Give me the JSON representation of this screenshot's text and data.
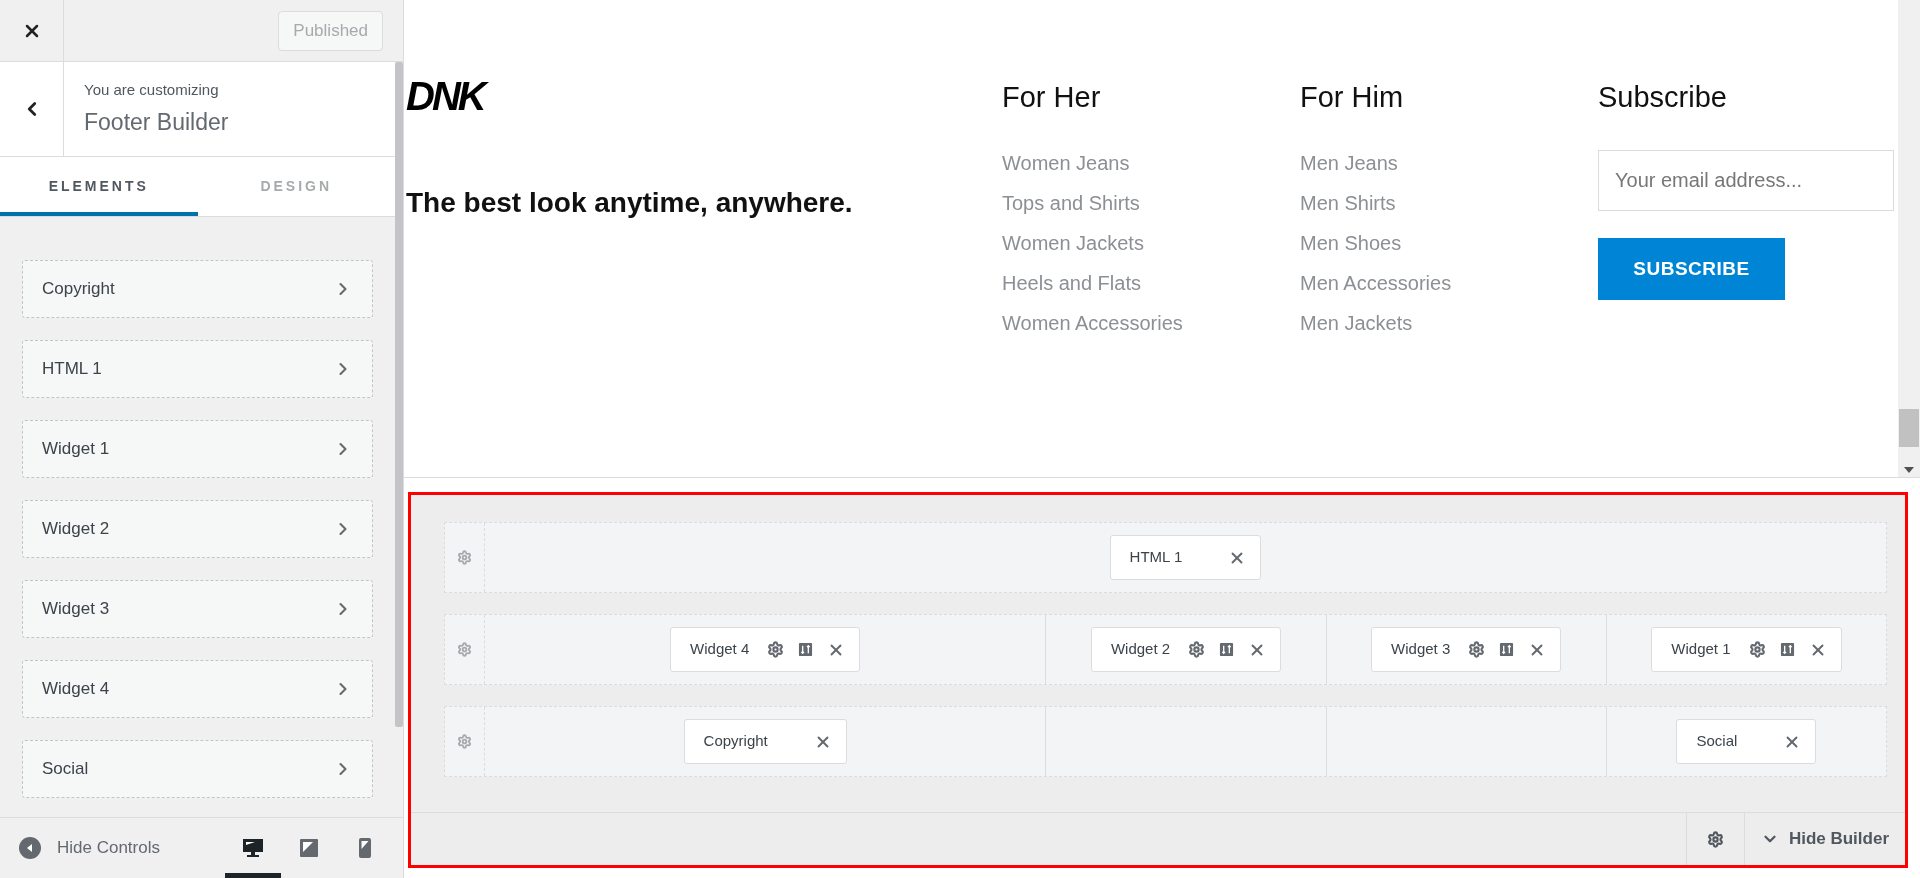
{
  "sidebar": {
    "status": "Published",
    "header": {
      "caption": "You are customizing",
      "title": "Footer Builder"
    },
    "tabs": [
      {
        "label": "ELEMENTS",
        "selected": true
      },
      {
        "label": "DESIGN",
        "selected": false
      }
    ],
    "items": [
      "Copyright",
      "HTML 1",
      "Widget 1",
      "Widget 2",
      "Widget 3",
      "Widget 4",
      "Social"
    ],
    "footer": {
      "hide_label": "Hide Controls",
      "devices": [
        {
          "kind": "desktop",
          "selected": true
        },
        {
          "kind": "tablet",
          "selected": false
        },
        {
          "kind": "mobile",
          "selected": false
        }
      ]
    }
  },
  "preview": {
    "logo": "DNK",
    "tagline": "The best look anytime, anywhere.",
    "columns": [
      {
        "heading": "For Her",
        "links": [
          "Women Jeans",
          "Tops and Shirts",
          "Women Jackets",
          "Heels and Flats",
          "Women Accessories"
        ]
      },
      {
        "heading": "For Him",
        "links": [
          "Men Jeans",
          "Men Shirts",
          "Men Shoes",
          "Men Accessories",
          "Men Jackets"
        ]
      }
    ],
    "subscribe": {
      "heading": "Subscribe",
      "placeholder": "Your email address...",
      "button": "SUBSCRIBE"
    }
  },
  "builder": {
    "rows": [
      {
        "columns": [
          [
            {
              "label": "HTML 1",
              "kind": "plain"
            }
          ]
        ]
      },
      {
        "columns": [
          [
            {
              "label": "Widget 4",
              "kind": "widget"
            }
          ],
          [
            {
              "label": "Widget 2",
              "kind": "widget"
            }
          ],
          [
            {
              "label": "Widget 3",
              "kind": "widget"
            }
          ],
          [
            {
              "label": "Widget 1",
              "kind": "widget"
            }
          ]
        ]
      },
      {
        "columns": [
          [
            {
              "label": "Copyright",
              "kind": "plain"
            }
          ],
          [],
          [],
          [
            {
              "label": "Social",
              "kind": "plain"
            }
          ]
        ]
      }
    ],
    "hide_label": "Hide Builder"
  }
}
